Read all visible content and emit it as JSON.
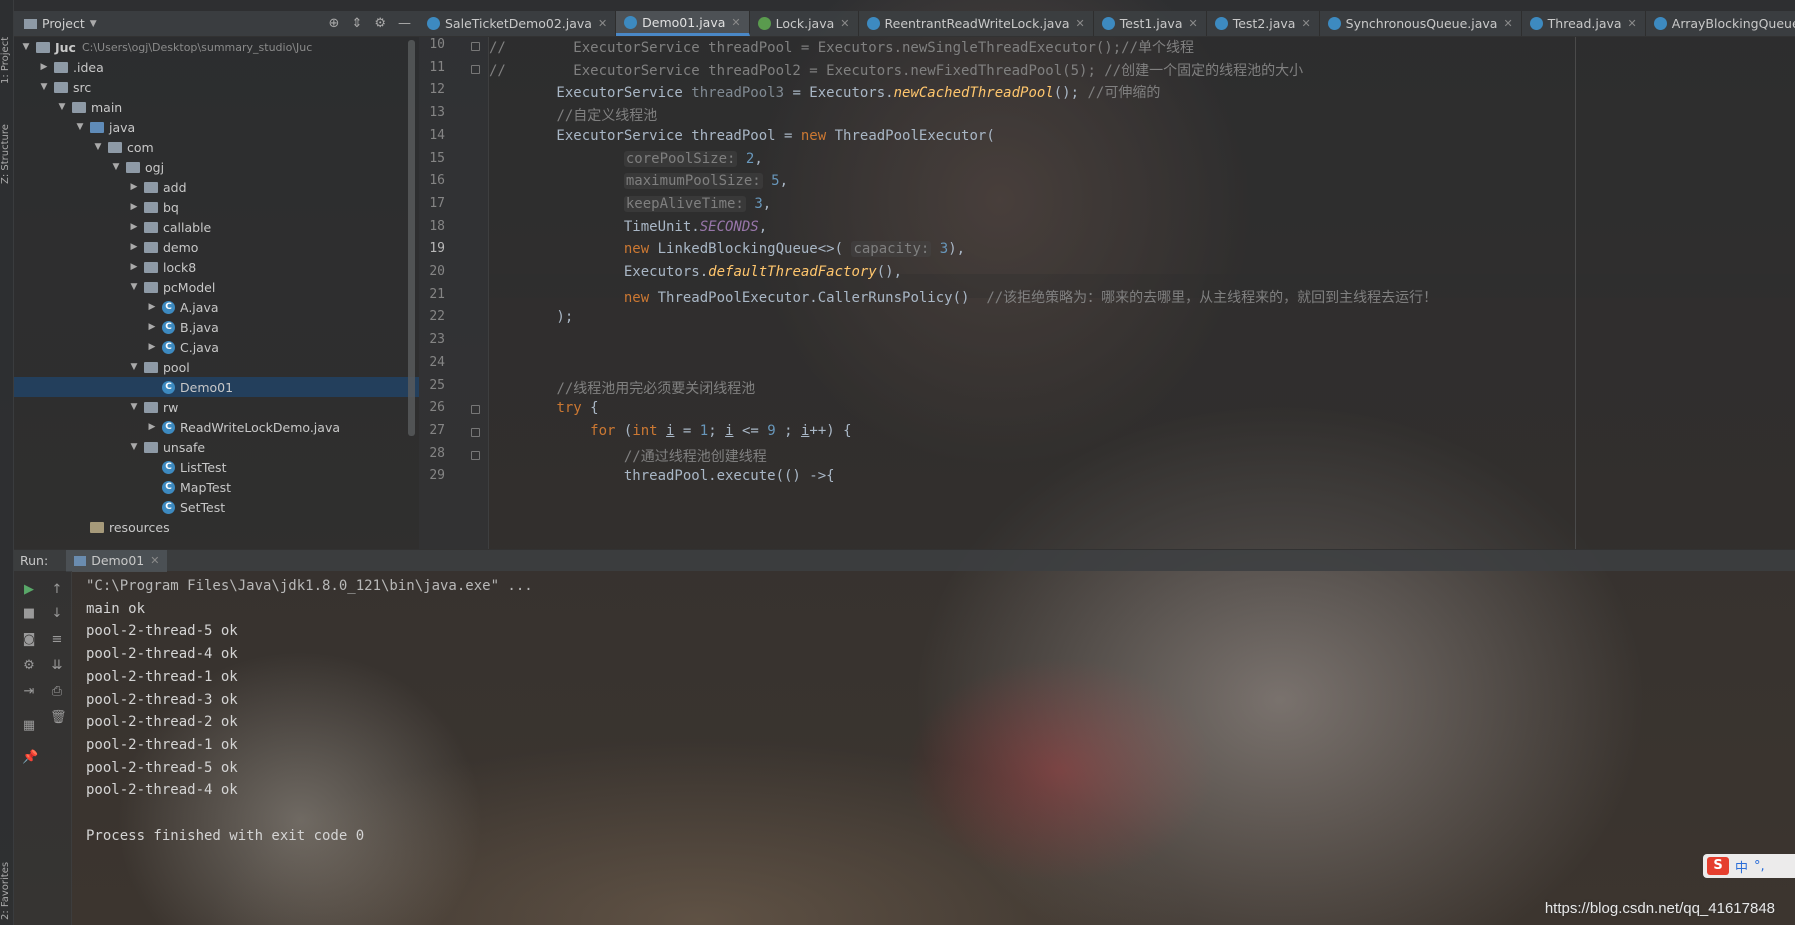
{
  "project_panel": {
    "title": "Project",
    "tree": [
      {
        "label": "Juc",
        "path": "C:\\Users\\ogj\\Desktop\\summary_studio\\Juc",
        "kind": "folder",
        "depth": 0,
        "open": true,
        "bold": true
      },
      {
        "label": ".idea",
        "kind": "folder",
        "depth": 1,
        "open": false
      },
      {
        "label": "src",
        "kind": "folder",
        "depth": 1,
        "open": true
      },
      {
        "label": "main",
        "kind": "folder",
        "depth": 2,
        "open": true
      },
      {
        "label": "java",
        "kind": "folder-blue",
        "depth": 3,
        "open": true
      },
      {
        "label": "com",
        "kind": "folder",
        "depth": 4,
        "open": true
      },
      {
        "label": "ogj",
        "kind": "folder",
        "depth": 5,
        "open": true
      },
      {
        "label": "add",
        "kind": "folder",
        "depth": 6,
        "open": false
      },
      {
        "label": "bq",
        "kind": "folder",
        "depth": 6,
        "open": false
      },
      {
        "label": "callable",
        "kind": "folder",
        "depth": 6,
        "open": false
      },
      {
        "label": "demo",
        "kind": "folder",
        "depth": 6,
        "open": false
      },
      {
        "label": "lock8",
        "kind": "folder",
        "depth": 6,
        "open": false
      },
      {
        "label": "pcModel",
        "kind": "folder",
        "depth": 6,
        "open": true
      },
      {
        "label": "A.java",
        "kind": "class",
        "depth": 7,
        "open": false
      },
      {
        "label": "B.java",
        "kind": "class",
        "depth": 7,
        "open": false
      },
      {
        "label": "C.java",
        "kind": "class",
        "depth": 7,
        "open": false
      },
      {
        "label": "pool",
        "kind": "folder",
        "depth": 6,
        "open": true
      },
      {
        "label": "Demo01",
        "kind": "class",
        "depth": 7,
        "selected": true,
        "leaf": true
      },
      {
        "label": "rw",
        "kind": "folder",
        "depth": 6,
        "open": true
      },
      {
        "label": "ReadWriteLockDemo.java",
        "kind": "class",
        "depth": 7,
        "open": false
      },
      {
        "label": "unsafe",
        "kind": "folder",
        "depth": 6,
        "open": true
      },
      {
        "label": "ListTest",
        "kind": "class",
        "depth": 7,
        "leaf": true
      },
      {
        "label": "MapTest",
        "kind": "class",
        "depth": 7,
        "leaf": true
      },
      {
        "label": "SetTest",
        "kind": "class",
        "depth": 7,
        "leaf": true
      },
      {
        "label": "resources",
        "kind": "folder-res",
        "depth": 3,
        "leaf": true
      }
    ]
  },
  "side_labels": {
    "project": "1: Project",
    "structure": "Z: Structure",
    "favorites": "2: Favorites"
  },
  "tabs": [
    {
      "label": "SaleTicketDemo02.java",
      "icon": "class-icon"
    },
    {
      "label": "Demo01.java",
      "icon": "class-icon",
      "active": true
    },
    {
      "label": "Lock.java",
      "icon": "lock-interface-icon"
    },
    {
      "label": "ReentrantReadWriteLock.java",
      "icon": "class-icon"
    },
    {
      "label": "Test1.java",
      "icon": "class-icon"
    },
    {
      "label": "Test2.java",
      "icon": "class-icon"
    },
    {
      "label": "SynchronousQueue.java",
      "icon": "class-icon"
    },
    {
      "label": "Thread.java",
      "icon": "class-icon"
    },
    {
      "label": "ArrayBlockingQueue.java",
      "icon": "class-icon"
    }
  ],
  "editor": {
    "current_line": 19,
    "lines": [
      {
        "no": 10,
        "html": "<span class=\"c\">//        ExecutorService threadPool = Executors.newSingleThreadExecutor();//单个线程</span>"
      },
      {
        "no": 11,
        "html": "<span class=\"c\">//        ExecutorService threadPool2 = Executors.newFixedThreadPool(5); //创建一个固定的线程池的大小</span>"
      },
      {
        "no": 12,
        "html": "        ExecutorService <span class=\"dim\">threadPool3</span> = Executors.<span class=\"i\">newCachedThreadPool</span>(); <span class=\"c\">//可伸缩的</span>"
      },
      {
        "no": 13,
        "html": "        <span class=\"c\">//自定义线程池</span>"
      },
      {
        "no": 14,
        "html": "        ExecutorService threadPool = <span class=\"k\">new</span> ThreadPoolExecutor("
      },
      {
        "no": 15,
        "html": "                <span class=\"hint\">corePoolSize:</span> <span class=\"n\">2</span>,"
      },
      {
        "no": 16,
        "html": "                <span class=\"hint\">maximumPoolSize:</span> <span class=\"n\">5</span>,"
      },
      {
        "no": 17,
        "html": "                <span class=\"hint\">keepAliveTime:</span> <span class=\"n\">3</span>,"
      },
      {
        "no": 18,
        "html": "                TimeUnit.<span class=\"f\">SECONDS</span>,"
      },
      {
        "no": 19,
        "html": "                <span class=\"k\">new</span> LinkedBlockingQueue&lt;&gt;( <span class=\"hint\">capacity:</span> <span class=\"n\">3</span>),"
      },
      {
        "no": 20,
        "html": "                Executors.<span class=\"i\">defaultThreadFactory</span>(),"
      },
      {
        "no": 21,
        "html": "                <span class=\"k\">new</span> ThreadPoolExecutor.CallerRunsPolicy()  <span class=\"c\">//该拒绝策略为：哪来的去哪里，从主线程来的，就回到主线程去运行！</span>"
      },
      {
        "no": 22,
        "html": "        );"
      },
      {
        "no": 23,
        "html": ""
      },
      {
        "no": 24,
        "html": ""
      },
      {
        "no": 25,
        "html": "        <span class=\"c\">//线程池用完必须要关闭线程池</span>"
      },
      {
        "no": 26,
        "html": "        <span class=\"k\">try</span> {"
      },
      {
        "no": 27,
        "html": "            <span class=\"k\">for</span> (<span class=\"k\">int</span> <u>i</u> = <span class=\"n\">1</span>; <u>i</u> &lt;= <span class=\"n\">9</span> ; <u>i</u>++) {"
      },
      {
        "no": 28,
        "html": "                <span class=\"c\">//通过线程池创建线程</span>"
      },
      {
        "no": 29,
        "html": "                threadPool.execute(() -&gt;{"
      }
    ]
  },
  "run_panel": {
    "label": "Run:",
    "tab": "Demo01",
    "output": [
      "\"C:\\Program Files\\Java\\jdk1.8.0_121\\bin\\java.exe\" ...",
      "main ok",
      "pool-2-thread-5 ok",
      "pool-2-thread-4 ok",
      "pool-2-thread-1 ok",
      "pool-2-thread-3 ok",
      "pool-2-thread-2 ok",
      "pool-2-thread-1 ok",
      "pool-2-thread-5 ok",
      "pool-2-thread-4 ok",
      "",
      "Process finished with exit code 0"
    ]
  },
  "ime": {
    "logo": "S",
    "mode": "中",
    "punct": "°,"
  },
  "watermark": "https://blog.csdn.net/qq_41617848"
}
